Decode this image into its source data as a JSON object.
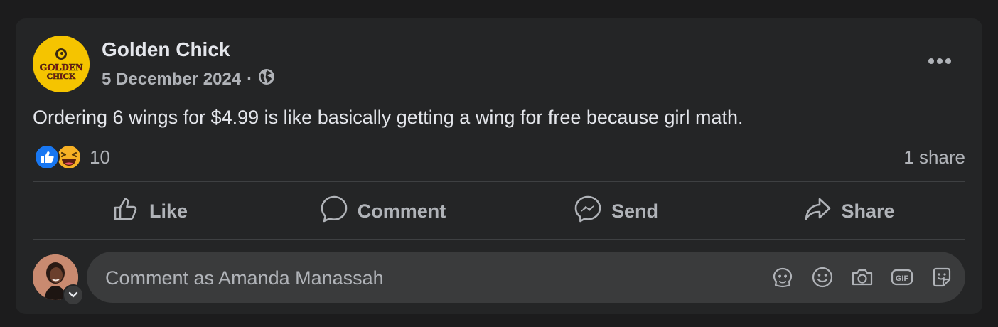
{
  "post": {
    "page_name": "Golden Chick",
    "date": "5 December 2024",
    "separator": "·",
    "audience_icon": "globe-icon",
    "logo_text_top": "GOLDEN",
    "logo_text_bottom": "CHICK",
    "text": "Ordering 6 wings for $4.99 is like basically getting a wing for free because girl math.",
    "more_icon": "more-options-icon"
  },
  "engagement": {
    "reaction_icons": [
      "like-reaction-icon",
      "haha-reaction-icon"
    ],
    "reaction_count": "10",
    "shares": "1 share"
  },
  "actions": [
    {
      "label": "Like",
      "icon": "thumbs-up-icon"
    },
    {
      "label": "Comment",
      "icon": "comment-bubble-icon"
    },
    {
      "label": "Send",
      "icon": "messenger-icon"
    },
    {
      "label": "Share",
      "icon": "share-arrow-icon"
    }
  ],
  "composer": {
    "placeholder": "Comment as Amanda Manassah",
    "value": "",
    "icons": [
      "avatar-sticker-icon",
      "emoji-icon",
      "camera-icon",
      "gif-icon",
      "sticker-icon"
    ]
  },
  "colors": {
    "background": "#1c1c1d",
    "card": "#242526",
    "primary_text": "#e4e6eb",
    "secondary_text": "#b0b3b8",
    "like_blue": "#1877f2",
    "logo_yellow": "#f5c400"
  }
}
